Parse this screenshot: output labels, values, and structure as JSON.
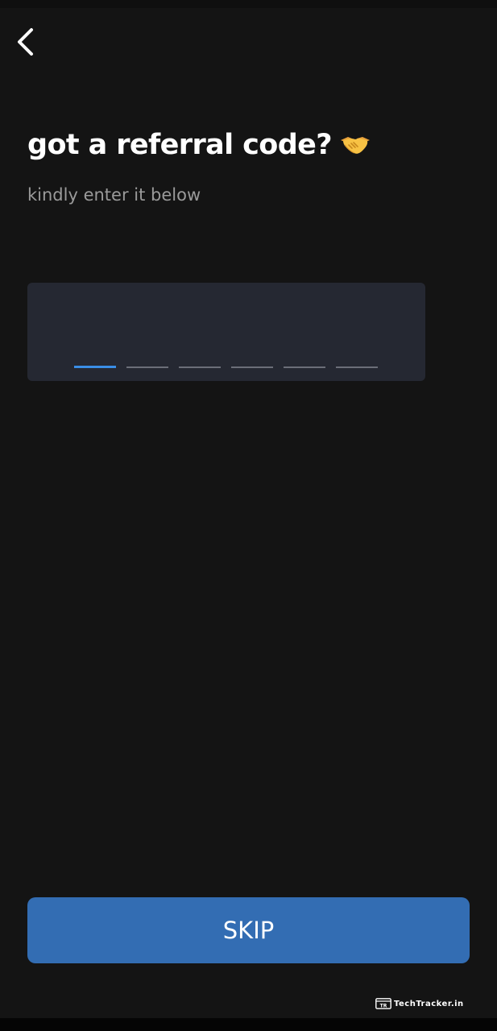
{
  "header": {
    "back_icon": "chevron-left-icon"
  },
  "content": {
    "title": "got a referral code?",
    "title_icon": "handshake-icon",
    "subtitle": "kindly enter it below"
  },
  "code_input": {
    "length": 6,
    "active_index": 0,
    "digits": [
      "",
      "",
      "",
      "",
      "",
      ""
    ]
  },
  "footer": {
    "skip_label": "SKIP"
  },
  "watermark": {
    "text": "TechTracker.in"
  },
  "colors": {
    "background": "#141414",
    "input_background": "#252832",
    "accent": "#3a8ee6",
    "button": "#336db3",
    "subtitle_text": "#9a9a9a"
  }
}
